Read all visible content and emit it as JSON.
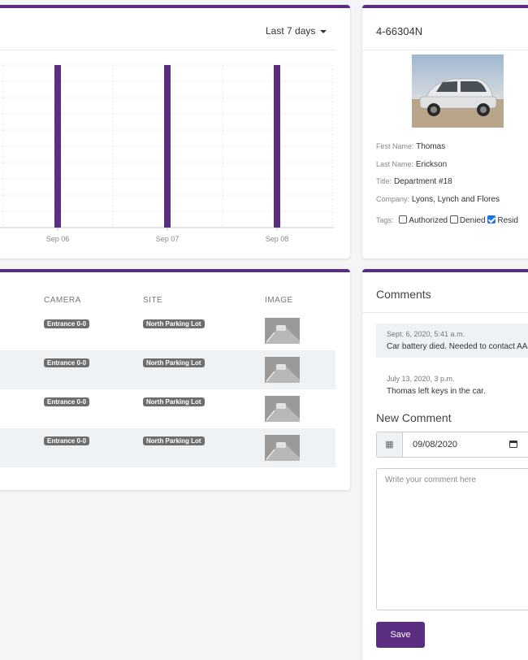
{
  "chart_card": {
    "period_label": "Last 7 days"
  },
  "chart_data": {
    "type": "bar",
    "categories": [
      "Sep 06",
      "Sep 07",
      "Sep 08"
    ],
    "values": [
      1,
      1,
      1
    ],
    "ylim": [
      0,
      1
    ],
    "grid": true,
    "bar_color": "#5a2d82"
  },
  "profile": {
    "plate": "4-66304N",
    "fields": [
      {
        "label": "First Name:",
        "value": "Thomas"
      },
      {
        "label": "Last Name:",
        "value": "Erickson"
      },
      {
        "label": "Title:",
        "value": "Department #18"
      },
      {
        "label": "Company:",
        "value": "Lyons, Lynch and Flores"
      }
    ],
    "tags_label": "Tags:",
    "tags": [
      {
        "label": "Authorized",
        "checked": false
      },
      {
        "label": "Denied",
        "checked": false
      },
      {
        "label": "Resid",
        "checked": true
      }
    ]
  },
  "table": {
    "headers": {
      "camera": "CAMERA",
      "site": "SITE",
      "image": "IMAGE"
    },
    "rows": [
      {
        "camera": "Entrance 0-0",
        "site": "North Parking Lot"
      },
      {
        "camera": "Entrance 0-0",
        "site": "North Parking Lot"
      },
      {
        "camera": "Entrance 0-0",
        "site": "North Parking Lot"
      },
      {
        "camera": "Entrance 0-0",
        "site": "North Parking Lot"
      }
    ]
  },
  "comments": {
    "title": "Comments",
    "items": [
      {
        "date": "Sept. 6, 2020, 5:41 a.m.",
        "text": "Car battery died. Needed to contact AA"
      },
      {
        "date": "July 13, 2020, 3 p.m.",
        "text": "Thomas left keys in the car."
      }
    ],
    "new_title": "New Comment",
    "date_value": "09/08/2020",
    "textarea_placeholder": "Write your comment here",
    "save_label": "Save"
  },
  "colors": {
    "accent": "#5a2d82",
    "badge": "#6e6e6e",
    "checkbox": "#1e73e8"
  }
}
